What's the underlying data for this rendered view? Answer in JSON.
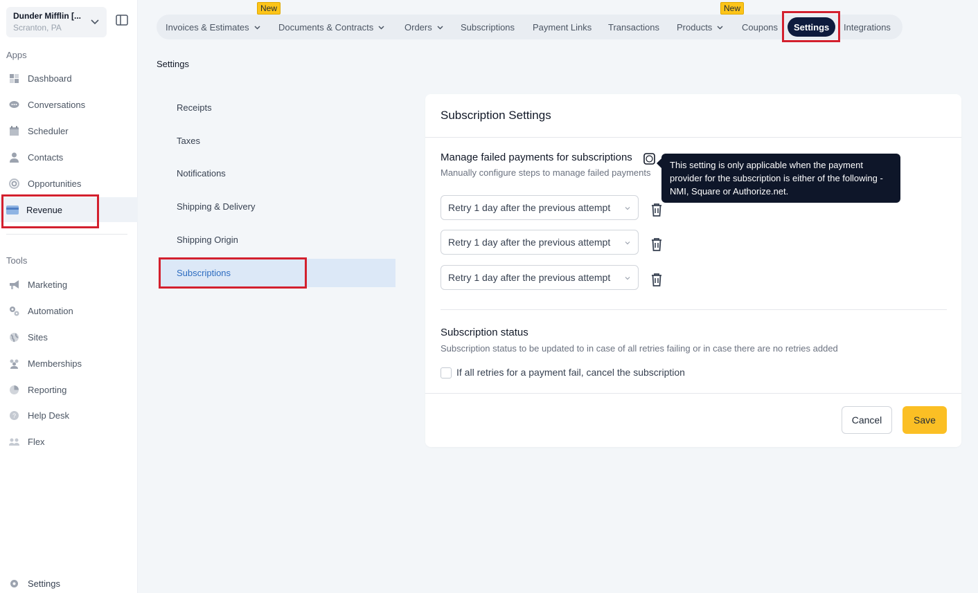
{
  "account": {
    "name": "Dunder Mifflin [...",
    "location": "Scranton, PA"
  },
  "sidebar": {
    "apps_label": "Apps",
    "apps": [
      {
        "label": "Dashboard",
        "icon": "dashboard-icon"
      },
      {
        "label": "Conversations",
        "icon": "conversations-icon"
      },
      {
        "label": "Scheduler",
        "icon": "calendar-icon"
      },
      {
        "label": "Contacts",
        "icon": "person-icon"
      },
      {
        "label": "Opportunities",
        "icon": "target-icon"
      },
      {
        "label": "Revenue",
        "icon": "credit-card-icon"
      }
    ],
    "tools_label": "Tools",
    "tools": [
      {
        "label": "Marketing",
        "icon": "megaphone-icon"
      },
      {
        "label": "Automation",
        "icon": "gears-icon"
      },
      {
        "label": "Sites",
        "icon": "globe-icon"
      },
      {
        "label": "Memberships",
        "icon": "users-icon"
      },
      {
        "label": "Reporting",
        "icon": "pie-chart-icon"
      },
      {
        "label": "Help Desk",
        "icon": "help-icon"
      },
      {
        "label": "Flex",
        "icon": "group-icon"
      }
    ],
    "settings_label": "Settings"
  },
  "topnav": {
    "tabs": [
      {
        "label": "Invoices & Estimates",
        "dropdown": true,
        "badge": "New"
      },
      {
        "label": "Documents & Contracts",
        "dropdown": true
      },
      {
        "label": "Orders",
        "dropdown": true
      },
      {
        "label": "Subscriptions"
      },
      {
        "label": "Payment Links"
      },
      {
        "label": "Transactions"
      },
      {
        "label": "Products",
        "dropdown": true,
        "badge": "New"
      },
      {
        "label": "Coupons"
      },
      {
        "label": "Settings",
        "active": true
      },
      {
        "label": "Integrations"
      }
    ]
  },
  "page_title": "Settings",
  "settings_menu": [
    "Receipts",
    "Taxes",
    "Notifications",
    "Shipping & Delivery",
    "Shipping Origin",
    "Subscriptions"
  ],
  "card": {
    "title": "Subscription Settings",
    "failed_payments": {
      "title": "Manage failed payments for subscriptions",
      "subtitle": "Manually configure steps to manage failed payments",
      "retries": [
        "Retry 1 day after the previous attempt",
        "Retry 1 day after the previous attempt",
        "Retry 1 day after the previous attempt"
      ]
    },
    "status": {
      "title": "Subscription status",
      "subtitle": "Subscription status to be updated to in case of all retries failing or in case there are no retries added",
      "checkbox_label": "If all retries for a payment fail, cancel the subscription"
    },
    "cancel_label": "Cancel",
    "save_label": "Save"
  },
  "tooltip": "This setting is only applicable when the payment provider for the subscription is either of the following - NMI, Square or Authorize.net.",
  "colors": {
    "accent": "#0e1b3d",
    "save": "#fbbf24",
    "active_menu": "#dce8f7",
    "highlight": "#d3202e",
    "badge": "#fcc419"
  }
}
